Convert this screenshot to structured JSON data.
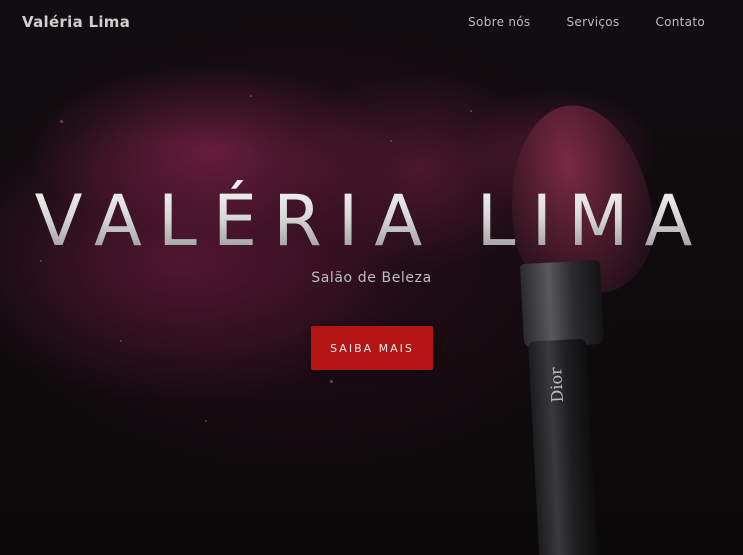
{
  "header": {
    "brand": "Valéria Lima",
    "nav": [
      {
        "label": "Sobre nós"
      },
      {
        "label": "Serviços"
      },
      {
        "label": "Contato"
      }
    ]
  },
  "hero": {
    "title": "VALÉRIA LIMA",
    "subtitle": "Salão de Beleza",
    "cta_label": "SAIBA MAIS",
    "brush_logo": "Dior"
  },
  "colors": {
    "accent": "#b31414",
    "background": "#0d0a0c",
    "powder": "#8c2a55"
  },
  "images": {
    "background": "makeup-brush-powder-burst-photo"
  }
}
